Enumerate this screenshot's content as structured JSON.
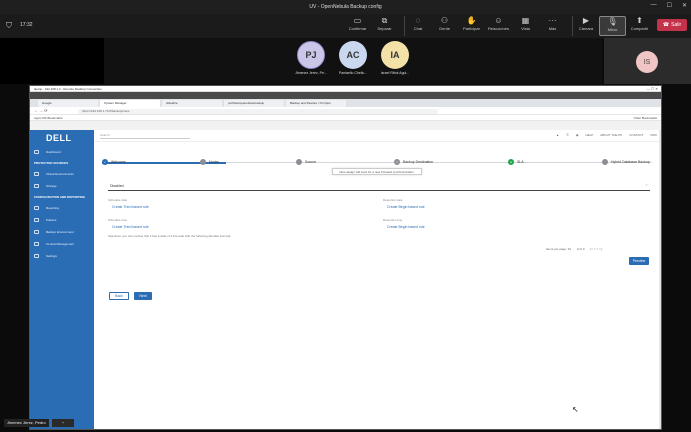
{
  "meeting": {
    "window_title": "UV - OpenNebula Backup config",
    "clock": "17:32",
    "tools": [
      {
        "label": "Confirmar",
        "icon": "present-icon"
      },
      {
        "label": "Separar",
        "icon": "share-icon"
      },
      {
        "label": "Chat",
        "icon": "chat-icon"
      },
      {
        "label": "Gente",
        "icon": "people-icon"
      },
      {
        "label": "Participar",
        "icon": "hand-icon"
      },
      {
        "label": "Reacciones",
        "icon": "emoji-icon"
      },
      {
        "label": "Vista",
        "icon": "grid-icon"
      },
      {
        "label": "Más",
        "icon": "more-icon"
      }
    ],
    "av_tools": [
      {
        "label": "Cámara",
        "icon": "camera-icon"
      },
      {
        "label": "Micro",
        "icon": "mic-icon"
      },
      {
        "label": "Compartir",
        "icon": "share-screen-icon"
      }
    ],
    "leave_label": "Salir",
    "participants": [
      {
        "initials": "PJ",
        "name": "Jimenez Jerez, Pe...",
        "color": "#c9c6e8"
      },
      {
        "initials": "AC",
        "name": "Pantaello Chelic...",
        "color": "#c9d8ef"
      },
      {
        "initials": "IA",
        "name": "Israel Ribot Agui...",
        "color": "#f3e1a8"
      }
    ],
    "self_initials": "IS",
    "name_tag": "Jimenez Jerez, Pedro"
  },
  "rdp": {
    "title": "laptop - 192.168.1.2 - Remote Desktop Connection",
    "tabs": [
      "Google",
      "System Manager",
      "vRealize",
      "portfolio/openebula-backup",
      "Backup and Restore / NI Open"
    ],
    "address": "https://192.168.1.71/#/backups/new",
    "bookmarks": "Apps  NIX  Bookmarks",
    "other_bookmarks": "Other Bookmarks"
  },
  "app": {
    "logo": "DELL",
    "sidebar": {
      "items_top": [
        {
          "label": "Dashboard"
        }
      ],
      "section1": "PROTECTED SOURCES",
      "items1": [
        {
          "label": "Virtual Environments"
        },
        {
          "label": "Storage"
        }
      ],
      "section2": "CONFIGURATION AND REPORTING",
      "items2": [
        {
          "label": "Reporting"
        },
        {
          "label": "Policies"
        },
        {
          "label": "Backup Environment"
        },
        {
          "label": "Central Management"
        },
        {
          "label": "Settings"
        }
      ]
    },
    "topnav": {
      "search_placeholder": "Search",
      "items": [
        "HELP",
        "ABOUT THE PP",
        "CONTACT",
        "PRO"
      ]
    },
    "steps": [
      {
        "label": "Welcome",
        "state": "done"
      },
      {
        "label": "Nodes",
        "state": "pending"
      },
      {
        "label": "Source",
        "state": "pending"
      },
      {
        "label": "Backup Destination",
        "state": "done"
      },
      {
        "label": "SLA",
        "state": "current"
      },
      {
        "label": "Hybrid Database Backup",
        "state": "pending"
      }
    ],
    "tooltip": "Now assign will work for a new Forward synchronization.",
    "select_value": "Disabled",
    "fields": {
      "left_label_1": "Schedule date",
      "left_value_1": "Create Third based rule",
      "right_label_1": "Retention date",
      "right_value_1": "Create Begin based rule",
      "left_label_2": "Schedule time",
      "left_value_2": "Create Third based rule",
      "right_label_2": "Retention time",
      "right_value_2": "Create Begin based rule"
    },
    "note": "Specimen you can confine that it has a data of 4 intervals with the following (Enable interval)",
    "pager": {
      "rows": "Items per page:  10",
      "range": "0 of 0"
    },
    "preview_label": "Preview",
    "back_label": "Back",
    "next_label": "Next"
  }
}
